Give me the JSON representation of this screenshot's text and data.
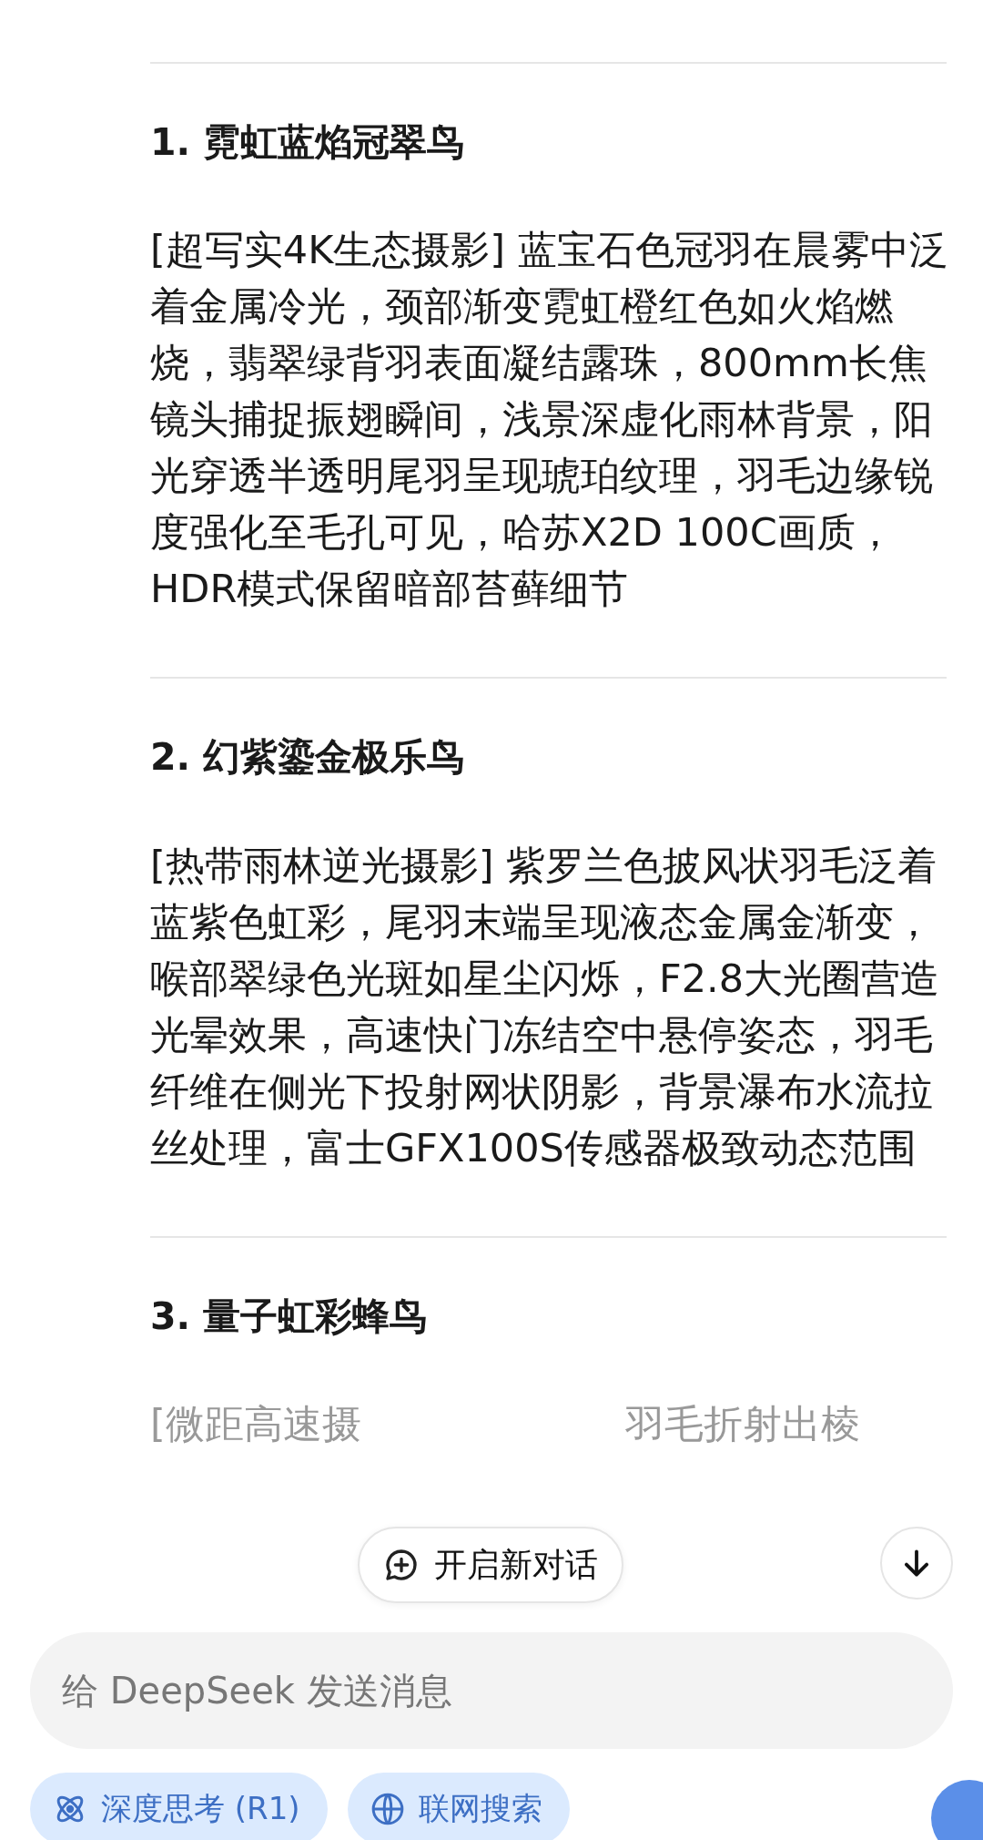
{
  "sections": [
    {
      "title": "1. 霓虹蓝焰冠翠鸟",
      "text": "[超写实4K生态摄影] 蓝宝石色冠羽在晨雾中泛着金属冷光，颈部渐变霓虹橙红色如火焰燃烧，翡翠绿背羽表面凝结露珠，800mm长焦镜头捕捉振翅瞬间，浅景深虚化雨林背景，阳光穿透半透明尾羽呈现琥珀纹理，羽毛边缘锐度强化至毛孔可见，哈苏X2D 100C画质，HDR模式保留暗部苔藓细节"
    },
    {
      "title": "2. 幻紫鎏金极乐鸟",
      "text": "[热带雨林逆光摄影] 紫罗兰色披风状羽毛泛着蓝紫色虹彩，尾羽末端呈现液态金属金渐变，喉部翠绿色光斑如星尘闪烁，F2.8大光圈营造光晕效果，高速快门冻结空中悬停姿态，羽毛纤维在侧光下投射网状阴影，背景瀑布水流拉丝处理，富士GFX100S传感器极致动态范围"
    }
  ],
  "last_section": {
    "title": "3. 量子虹彩蜂鸟",
    "text_fragments": [
      "[微距高速摄",
      "羽毛折射出棱"
    ]
  },
  "new_chat_button": {
    "label": "开启新对话"
  },
  "input": {
    "placeholder": "给 DeepSeek 发送消息"
  },
  "toggles": [
    {
      "kind": "think",
      "label": "深度思考 (R1)",
      "selected": true
    },
    {
      "kind": "search",
      "label": "联网搜索",
      "selected": true
    }
  ]
}
